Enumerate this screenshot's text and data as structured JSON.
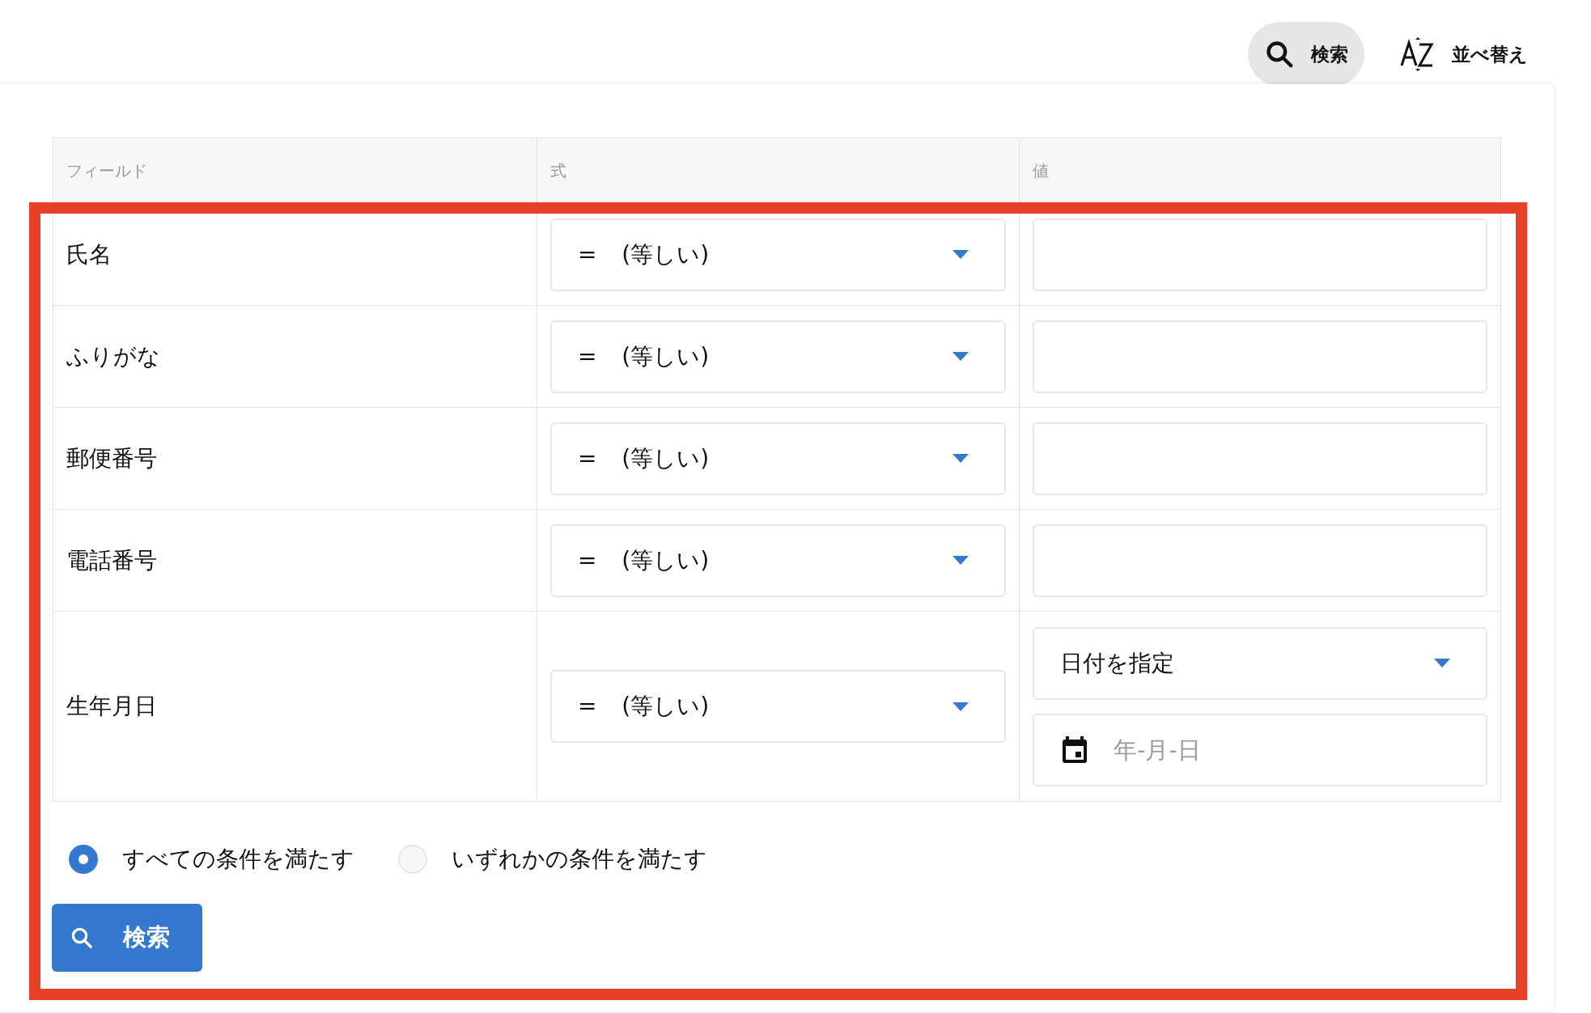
{
  "toolbar": [
    {
      "kind": "search",
      "label": "検索",
      "selected": true
    },
    {
      "kind": "sort",
      "label": "並べ替え",
      "selected": false
    }
  ],
  "table": {
    "columns": [
      "フィールド",
      "式",
      "値"
    ],
    "rows": [
      {
        "field": "氏名",
        "operator": "= (等しい)",
        "kind": "text"
      },
      {
        "field": "ふりがな",
        "operator": "= (等しい)",
        "kind": "text"
      },
      {
        "field": "郵便番号",
        "operator": "= (等しい)",
        "kind": "text"
      },
      {
        "field": "電話番号",
        "operator": "= (等しい)",
        "kind": "text"
      },
      {
        "field": "生年月日",
        "operator": "= (等しい)",
        "kind": "date",
        "date_mode": "日付を指定",
        "placeholder": "年-月-日"
      }
    ]
  },
  "match": [
    {
      "label": "すべての条件を満たす",
      "selected": true
    },
    {
      "label": "いずれかの条件を満たす",
      "selected": false
    }
  ],
  "submit": {
    "label": "検索"
  }
}
